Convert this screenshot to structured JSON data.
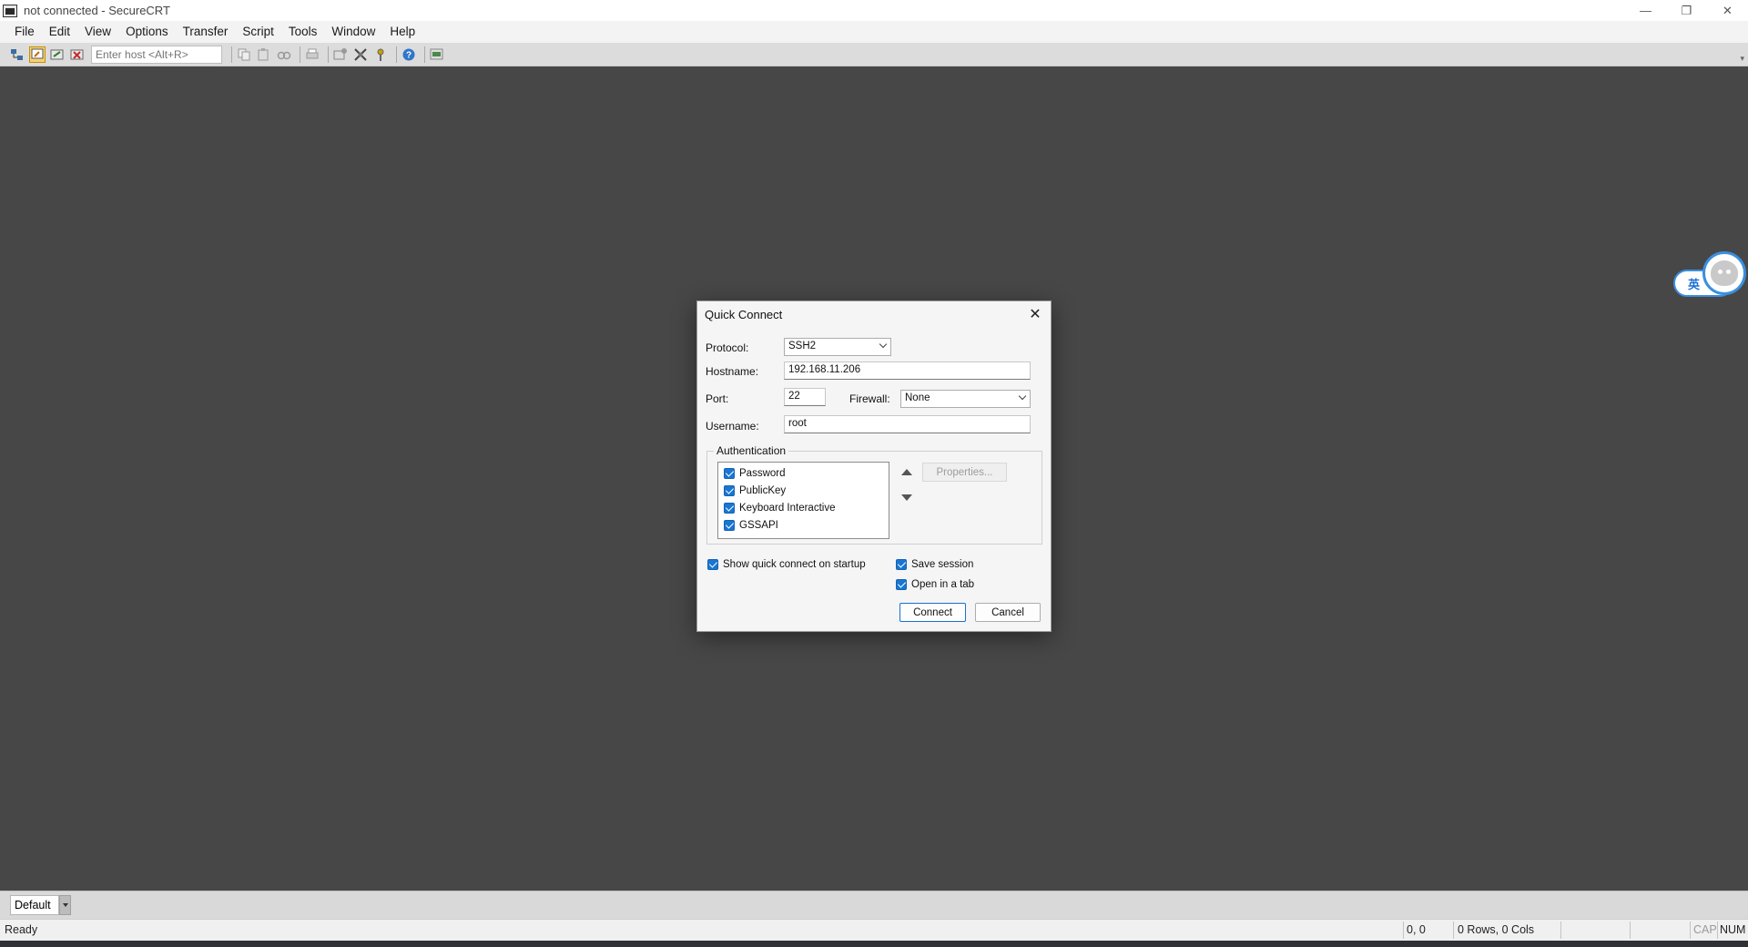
{
  "window": {
    "title": "not connected - SecureCRT",
    "controls": [
      "—",
      "❐",
      "✕"
    ]
  },
  "menu": [
    "File",
    "Edit",
    "View",
    "Options",
    "Transfer",
    "Script",
    "Tools",
    "Window",
    "Help"
  ],
  "toolbar": {
    "host_placeholder": "Enter host <Alt+R>"
  },
  "ime": {
    "label": "英"
  },
  "dialog": {
    "title": "Quick Connect",
    "protocol_label": "Protocol:",
    "protocol_value": "SSH2",
    "hostname_label": "Hostname:",
    "hostname_value": "192.168.11.206",
    "port_label": "Port:",
    "port_value": "22",
    "firewall_label": "Firewall:",
    "firewall_value": "None",
    "username_label": "Username:",
    "username_value": "root",
    "auth_title": "Authentication",
    "auth_items": [
      "Password",
      "PublicKey",
      "Keyboard Interactive",
      "GSSAPI"
    ],
    "properties_label": "Properties...",
    "show_quick_connect": "Show quick connect on startup",
    "save_session": "Save session",
    "open_in_tab": "Open in a tab",
    "connect_label": "Connect",
    "cancel_label": "Cancel"
  },
  "tabs": {
    "default_label": "Default"
  },
  "status": {
    "ready": "Ready",
    "cursor": "0, 0",
    "dimensions": "0 Rows, 0 Cols",
    "cap": "CAP",
    "num": "NUM"
  },
  "colors": {
    "desktop": "#474747",
    "accent": "#1976d2"
  }
}
